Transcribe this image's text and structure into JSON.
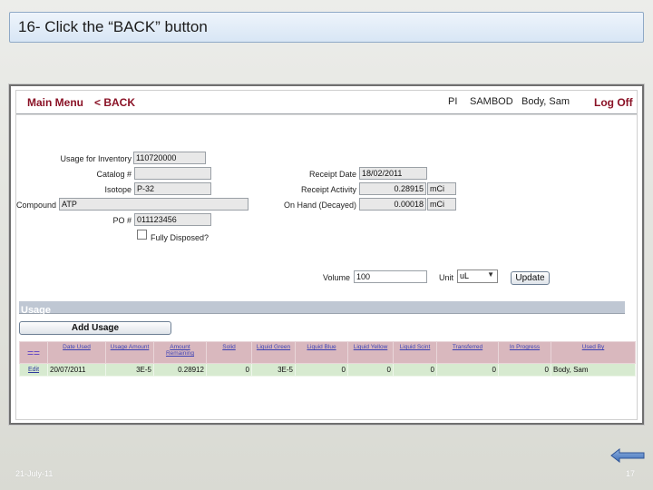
{
  "slide": {
    "title": "16- Click the “BACK” button",
    "date": "21-July-11",
    "page_number": "17"
  },
  "header": {
    "main_menu": "Main Menu",
    "back": "< BACK",
    "pi_label": "PI",
    "pi_code": "SAMBOD",
    "user_name": "Body, Sam",
    "log_off": "Log Off"
  },
  "form": {
    "usage_for_inventory": {
      "label": "Usage for Inventory",
      "value": "110720000"
    },
    "catalog": {
      "label": "Catalog #",
      "value": ""
    },
    "isotope": {
      "label": "Isotope",
      "value": "P-32"
    },
    "compound": {
      "label": "Compound",
      "value": "ATP"
    },
    "po": {
      "label": "PO #",
      "value": "011123456"
    },
    "fully_disposed": {
      "label": "Fully Disposed?",
      "checked": false
    },
    "receipt_date": {
      "label": "Receipt Date",
      "value": "18/02/2011"
    },
    "receipt_activity": {
      "label": "Receipt Activity",
      "value": "0.28915",
      "unit": "mCi"
    },
    "on_hand": {
      "label": "On Hand (Decayed)",
      "value": "0.00018",
      "unit": "mCi"
    },
    "volume": {
      "label": "Volume",
      "value": "100"
    },
    "unit": {
      "label": "Unit",
      "value": "uL"
    },
    "update_button": "Update"
  },
  "usage": {
    "section_title": "Usage",
    "add_button": "Add Usage",
    "columns": [
      "==",
      "Date Used",
      "Usage Amount",
      "Amount Remaining",
      "Solid",
      "Liquid Green",
      "Liquid Blue",
      "Liquid Yellow",
      "Liquid Scint",
      "Transferred",
      "In Progress",
      "Used By"
    ],
    "rows": [
      {
        "edit": "Edit",
        "cells": [
          "20/07/2011",
          "3E-5",
          "0.28912",
          "0",
          "3E-5",
          "0",
          "0",
          "0",
          "0",
          "0",
          "Body, Sam"
        ]
      }
    ]
  }
}
